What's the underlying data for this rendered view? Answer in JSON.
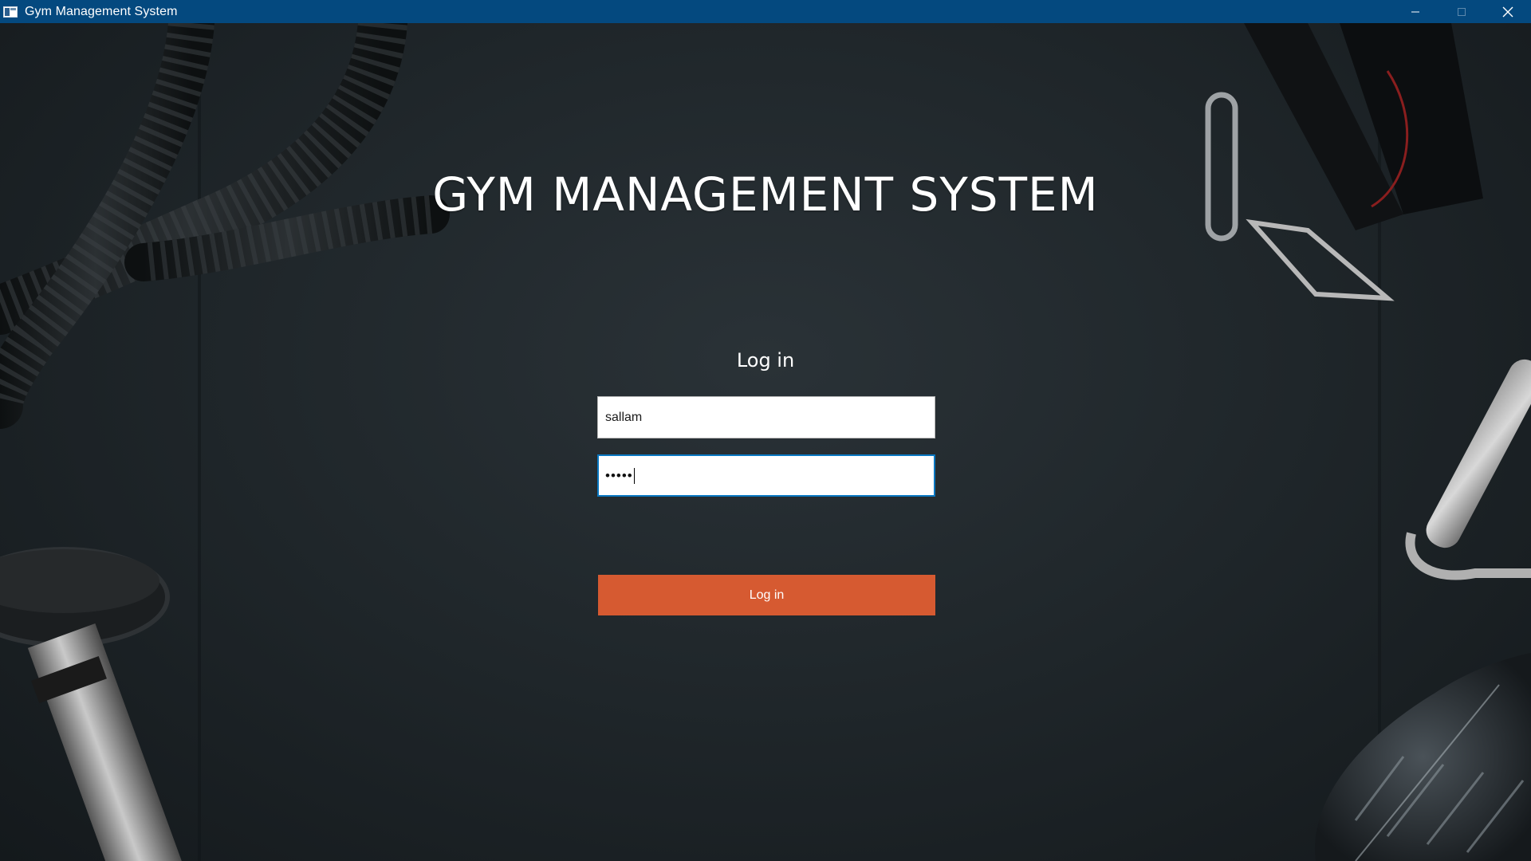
{
  "window": {
    "title": "Gym Management System",
    "controls": {
      "minimize_icon": "minimize-icon",
      "maximize_icon": "maximize-icon",
      "close_icon": "close-icon"
    },
    "titlebar_color": "#04497f"
  },
  "main": {
    "heading": "GYM MANAGEMENT SYSTEM",
    "form_title": "Log in",
    "username_value": "sallam",
    "password_masked": "•••••",
    "login_button_label": "Log in",
    "accent_color": "#d65a31",
    "focus_color": "#0a78c2"
  }
}
